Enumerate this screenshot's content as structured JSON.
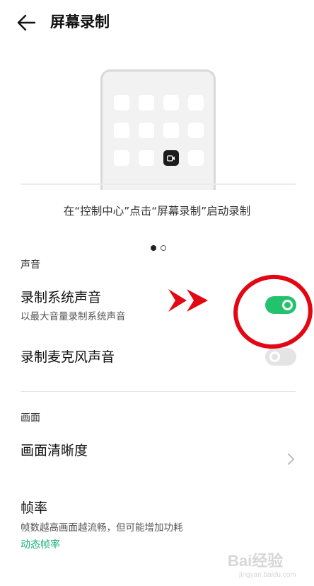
{
  "header": {
    "title": "屏幕录制"
  },
  "illustration": {
    "caption": "在“控制中心”点击“屏幕录制”启动录制",
    "page_dots": 2,
    "active_dot": 1
  },
  "sound_section": {
    "label": "声音",
    "system_audio": {
      "title": "录制系统声音",
      "subtitle": "以最大音量录制系统声音",
      "enabled": true
    },
    "mic_audio": {
      "title": "录制麦克风声音",
      "enabled": false
    }
  },
  "display_section": {
    "label": "画面",
    "resolution": {
      "title": "画面清晰度"
    },
    "frame_rate": {
      "title": "帧率",
      "subtitle": "帧数越高画面越流畅，但可能增加功耗",
      "value": "动态帧率"
    }
  },
  "watermark": {
    "text": "Bai经验",
    "url": "jingyan.baidu.com"
  },
  "colors": {
    "toggle_on": "#23c36d",
    "toggle_off": "#e4e4e4",
    "link": "#1ab276",
    "annotation": "#e30613"
  },
  "icons": {
    "back": "arrow-left-icon",
    "chevron": "chevron-right-icon",
    "record": "video-camera-icon"
  }
}
